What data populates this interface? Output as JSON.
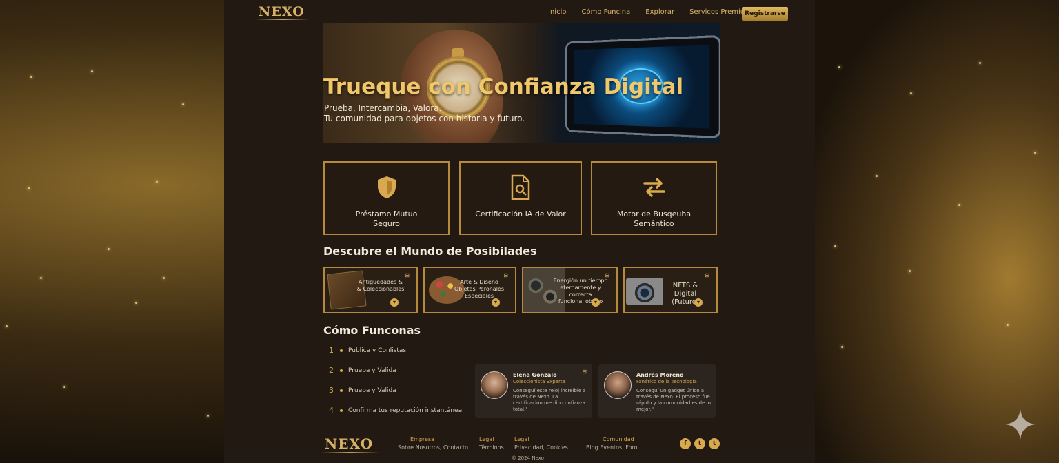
{
  "brand": {
    "logo": "NEXO"
  },
  "nav": {
    "items": [
      "Inicio",
      "Cómo Funcina",
      "Explorar",
      "Servicos Premium"
    ],
    "register_label": "Registrarse"
  },
  "hero": {
    "title": "Trueque con Confianza Digital",
    "subtitle_line1": "Prueba, Intercambia, Valora.",
    "subtitle_line2": "Tu comunidad para objetos con historia y futuro."
  },
  "features": [
    {
      "icon": "shield-icon",
      "label_line1": "Préstamo Mutuo",
      "label_line2": "Seguro"
    },
    {
      "icon": "document-search-icon",
      "label_line1": "Certificación IA de Valor",
      "label_line2": ""
    },
    {
      "icon": "swap-arrows-icon",
      "label_line1": "Motor de Busqeuha",
      "label_line2": "Semántico"
    }
  ],
  "discover": {
    "title": "Descubre el Mundo de Posibilades",
    "categories": [
      {
        "thumb": "old-book",
        "line1": "Antigüedades &",
        "line2": "& Coleccionables",
        "line3": ""
      },
      {
        "thumb": "paint-palette",
        "line1": "Arte & Diseño",
        "line2": "Objetos Peronales",
        "line3": "Especiales"
      },
      {
        "thumb": "gears",
        "line1": "Energión un tiempo",
        "line2": "eternamente y correcta",
        "line3": "funcional objeto"
      },
      {
        "thumb": "camera",
        "line1": "NFTS & Digital",
        "line2": "(Futuro)",
        "line3": ""
      }
    ]
  },
  "how": {
    "title": "Cómo Funconas",
    "steps": [
      {
        "num": "1",
        "label": "Publica y Conlistas"
      },
      {
        "num": "2",
        "label": "Prueba y Valida"
      },
      {
        "num": "3",
        "label": "Prueba y Valida"
      },
      {
        "num": "4",
        "label": "Confirma tus reputación instantánea."
      }
    ]
  },
  "testimonials": [
    {
      "name": "Elena Gonzalo",
      "role": "Coleccionista Experta",
      "quote": "Conseguí este reloj increíble a través de Nexo. La certificación me dio confianza total.\""
    },
    {
      "name": "Andrés Moreno",
      "role": "Fanático de la Tecnología",
      "quote": "Conseguí un gadget único a través de Nexo. El proceso fue rápido y la comunidad es de lo mejor.\""
    }
  ],
  "footer": {
    "logo": "NEXO",
    "columns": [
      {
        "head": "Empresa",
        "links": "Sobre Nosotros, Contacto"
      },
      {
        "head": "Legal",
        "links": "Términos"
      },
      {
        "head": "Legal",
        "links": "Privacidad, Cookies"
      },
      {
        "head": "Comunidad",
        "links": "Blog   Eventos, Foro"
      }
    ],
    "social": [
      "f",
      "t",
      "t"
    ],
    "copyright": "© 2024 Nexo"
  },
  "colors": {
    "gold": "#d8a94e",
    "page_bg": "#221913",
    "text": "#efe4cf"
  }
}
